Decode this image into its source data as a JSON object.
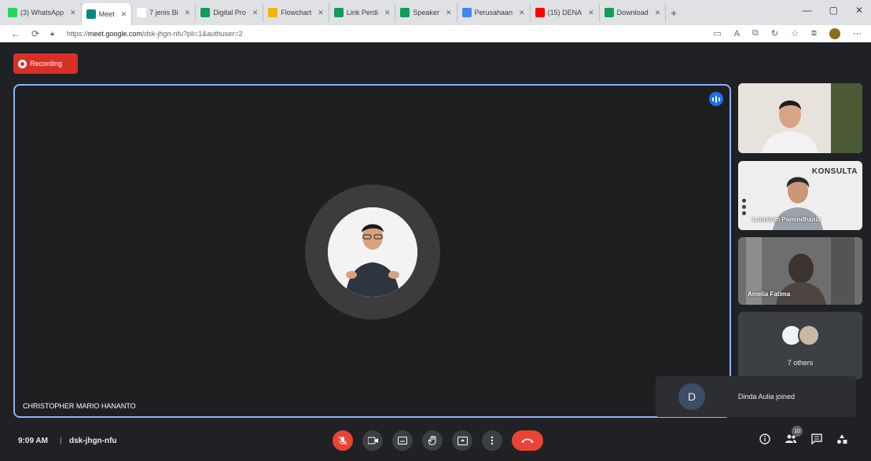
{
  "browser": {
    "tabs": [
      {
        "label": "(3) WhatsApp",
        "fav": "#25d366"
      },
      {
        "label": "Meet",
        "fav": "#00897b",
        "active": true
      },
      {
        "label": "7 jenis Bi",
        "fav": "#ffffff"
      },
      {
        "label": "Digital Pro",
        "fav": "#0f9d58"
      },
      {
        "label": "Flowchart",
        "fav": "#f4b400"
      },
      {
        "label": "Link Perdi",
        "fav": "#0f9d58"
      },
      {
        "label": "Speaker",
        "fav": "#0f9d58"
      },
      {
        "label": "Perusahaan",
        "fav": "#4285f4"
      },
      {
        "label": "(15) DENA",
        "fav": "#ff0000"
      },
      {
        "label": "Download",
        "fav": "#0f9d58"
      }
    ],
    "new_tab": "+",
    "window_controls": [
      "—",
      "▢",
      "✕"
    ],
    "url_prefix": "https://",
    "url_host": "meet.google.com",
    "url_path": "/dsk-jhgn-nfu?pli=1&authuser=2"
  },
  "meeting": {
    "recording_label": "Recording",
    "main_speaker": "CHRISTOPHER MARIO HANANTO",
    "participants": [
      {
        "name": ""
      },
      {
        "name": "Lamanan Pamindhania",
        "logo": "KONSULTA"
      },
      {
        "name": "Amelia Fatima"
      }
    ],
    "others_label": "7 others",
    "toast": {
      "initial": "D",
      "message": "Dinda Aulia joined"
    },
    "participant_count": "10"
  },
  "footer": {
    "time": "9:09 AM",
    "separator": "|",
    "meeting_code": "dsk-jhgn-nfu"
  }
}
